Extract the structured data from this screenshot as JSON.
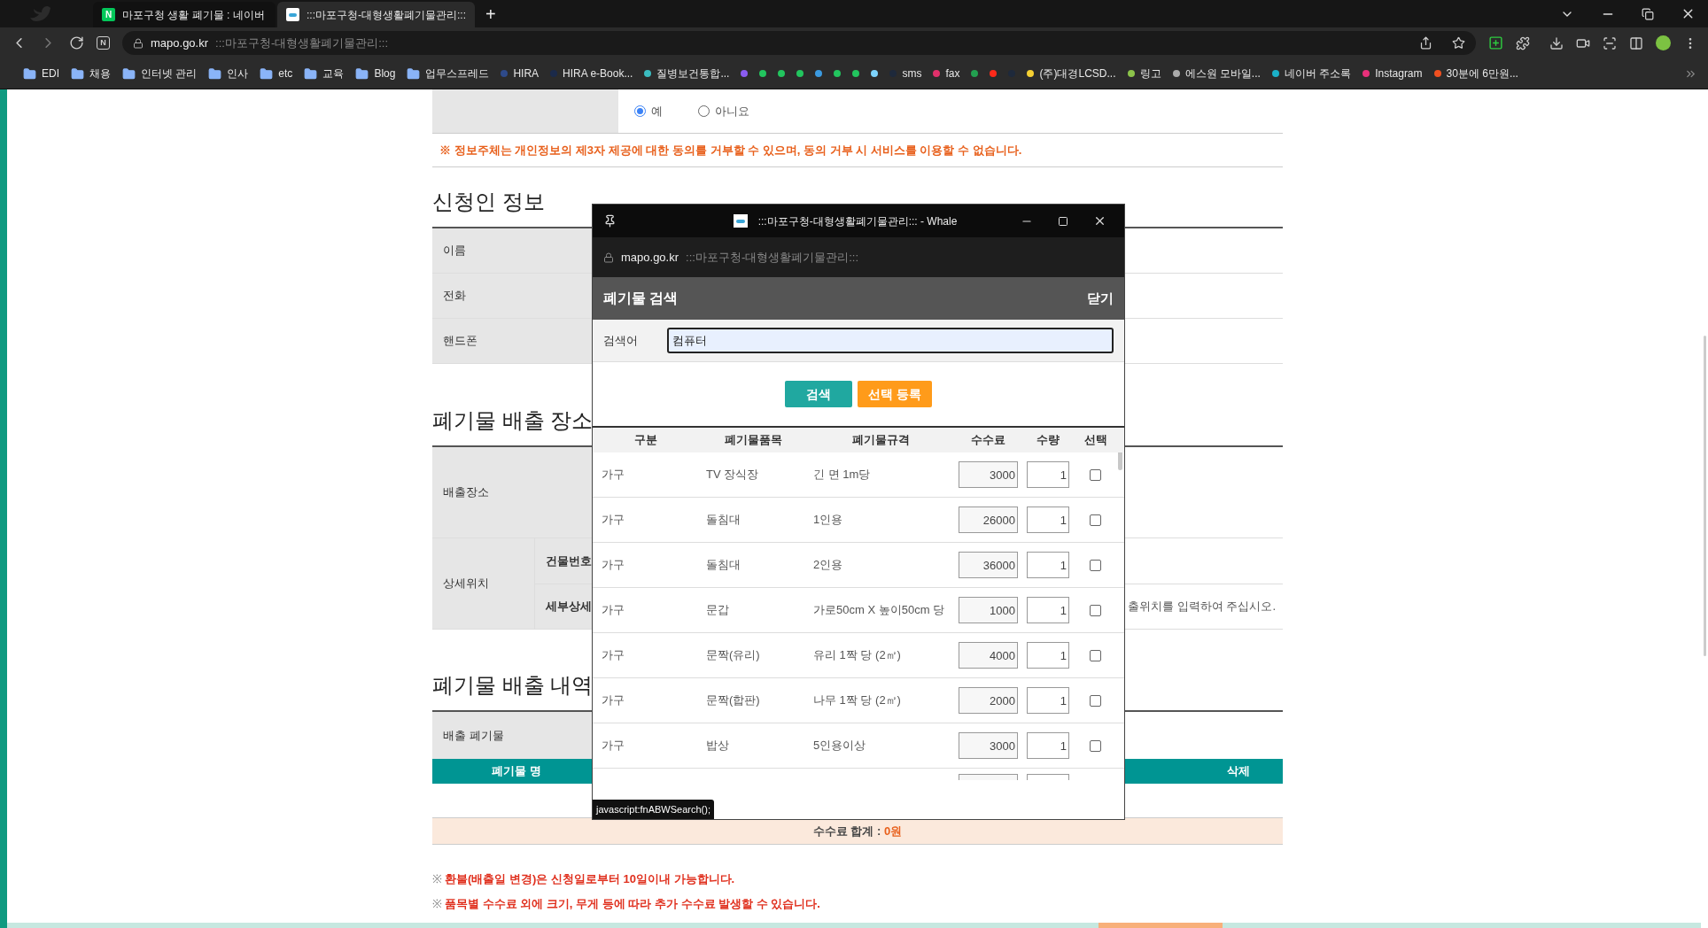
{
  "browser": {
    "tabs": [
      {
        "title": "마포구청 생활 폐기물 : 네이버",
        "favicon": "N",
        "selected": false
      },
      {
        "title": ":::마포구청-대형생활폐기물관리:::",
        "selected": true
      }
    ],
    "new_tab": "+",
    "home": "N",
    "address": {
      "host": "mapo.go.kr",
      "title": ":::마포구청-대형생활폐기물관리:::"
    },
    "bookmarks": [
      {
        "kind": "folder",
        "label": "EDI"
      },
      {
        "kind": "folder",
        "label": "채용"
      },
      {
        "kind": "folder",
        "label": "인터넷 관리"
      },
      {
        "kind": "folder",
        "label": "인사"
      },
      {
        "kind": "folder",
        "label": "etc"
      },
      {
        "kind": "folder",
        "label": "교육"
      },
      {
        "kind": "folder",
        "label": "Blog"
      },
      {
        "kind": "folder",
        "label": "업무스프레드"
      },
      {
        "kind": "site",
        "label": "HIRA",
        "color": "#2e4a8a"
      },
      {
        "kind": "site",
        "label": "HIRA e-Book...",
        "color": "#1b2a4a"
      },
      {
        "kind": "site",
        "label": "질병보건통합...",
        "color": "#3bbcc0"
      },
      {
        "kind": "site",
        "color": "#8a5cf0"
      },
      {
        "kind": "site",
        "color": "#22c55e"
      },
      {
        "kind": "site",
        "color": "#22c55e"
      },
      {
        "kind": "site",
        "color": "#22c55e"
      },
      {
        "kind": "site",
        "color": "#3b9ae0"
      },
      {
        "kind": "site",
        "color": "#22c55e"
      },
      {
        "kind": "site",
        "color": "#22c55e"
      },
      {
        "kind": "site",
        "color": "#7dd3fc"
      },
      {
        "kind": "site",
        "label": "sms",
        "color": "#1e293b"
      },
      {
        "kind": "site",
        "label": "fax",
        "color": "#e0306a"
      },
      {
        "kind": "site",
        "color": "#22a050"
      },
      {
        "kind": "site",
        "color": "#ff2a1a"
      },
      {
        "kind": "site",
        "color": "#1e293b"
      },
      {
        "kind": "site",
        "label": "(주)대경LCSD...",
        "color": "#f5d033"
      },
      {
        "kind": "site",
        "label": "링고",
        "color": "#8bc34a"
      },
      {
        "kind": "site",
        "label": "에스원 모바일...",
        "color": "#aaaaaa"
      },
      {
        "kind": "site",
        "label": "네이버 주소록",
        "color": "#1ab0c8"
      },
      {
        "kind": "site",
        "label": "Instagram",
        "color": "#e8307a"
      },
      {
        "kind": "site",
        "label": "30분에 6만원...",
        "color": "#f05020"
      }
    ]
  },
  "consent": {
    "options": [
      {
        "label": "예",
        "selected": true
      },
      {
        "label": "아니요",
        "selected": false
      }
    ],
    "note": "※ 정보주체는 개인정보의 제3자 제공에 대한 동의를 거부할 수 있으며, 동의 거부 시 서비스를 이용할 수 없습니다."
  },
  "applicant": {
    "title": "신청인 정보",
    "rows": [
      "이름",
      "전화",
      "핸드폰"
    ]
  },
  "location": {
    "title": "폐기물 배출 장소",
    "place_label": "배출장소",
    "detail_label": "상세위치",
    "sub_labels": [
      "건물번호",
      "세부상세"
    ],
    "hint": "출위치를 입력하여 주십시오."
  },
  "emission": {
    "title": "폐기물 배출 내역",
    "row_label": "배출 폐기물",
    "columns": [
      "폐기물 명",
      "삭제"
    ],
    "total_label": "수수료 합계 : ",
    "total_value": "0원"
  },
  "notes": [
    {
      "mark": "※",
      "text": "환불(배출일 변경)은 신청일로부터 10일이내 가능합니다."
    },
    {
      "mark": "※",
      "text": "품목별 수수료 외에 크기, 무게 등에 따라 추가 수수료 발생할 수 있습니다."
    }
  ],
  "popup": {
    "window_title": ":::마포구청-대형생활폐기물관리::: - Whale",
    "host": "mapo.go.kr",
    "page_title": ":::마포구청-대형생활폐기물관리:::",
    "title": "폐기물 검색",
    "close": "닫기",
    "search_label": "검색어",
    "search_value": "컴퓨터",
    "buttons": [
      "검색",
      "선택 등록"
    ],
    "columns": [
      "구분",
      "폐기물품목",
      "폐기물규격",
      "수수료",
      "수량",
      "선택"
    ],
    "rows": [
      {
        "category": "가구",
        "item": "TV 장식장",
        "spec": "긴 면 1m당",
        "fee": "3000",
        "qty": "1",
        "selected": false
      },
      {
        "category": "가구",
        "item": "돌침대",
        "spec": "1인용",
        "fee": "26000",
        "qty": "1",
        "selected": false
      },
      {
        "category": "가구",
        "item": "돌침대",
        "spec": "2인용",
        "fee": "36000",
        "qty": "1",
        "selected": false
      },
      {
        "category": "가구",
        "item": "문갑",
        "spec": "가로50cm X 높이50cm 당",
        "fee": "1000",
        "qty": "1",
        "selected": false
      },
      {
        "category": "가구",
        "item": "문짝(유리)",
        "spec": "유리 1짝 당 (2㎡)",
        "fee": "4000",
        "qty": "1",
        "selected": false
      },
      {
        "category": "가구",
        "item": "문짝(합판)",
        "spec": "나무 1짝 당 (2㎡)",
        "fee": "2000",
        "qty": "1",
        "selected": false
      },
      {
        "category": "가구",
        "item": "밥상",
        "spec": "5인용이상",
        "fee": "3000",
        "qty": "1",
        "selected": false
      }
    ],
    "status_url": "javascript:fnABWSearch();"
  }
}
